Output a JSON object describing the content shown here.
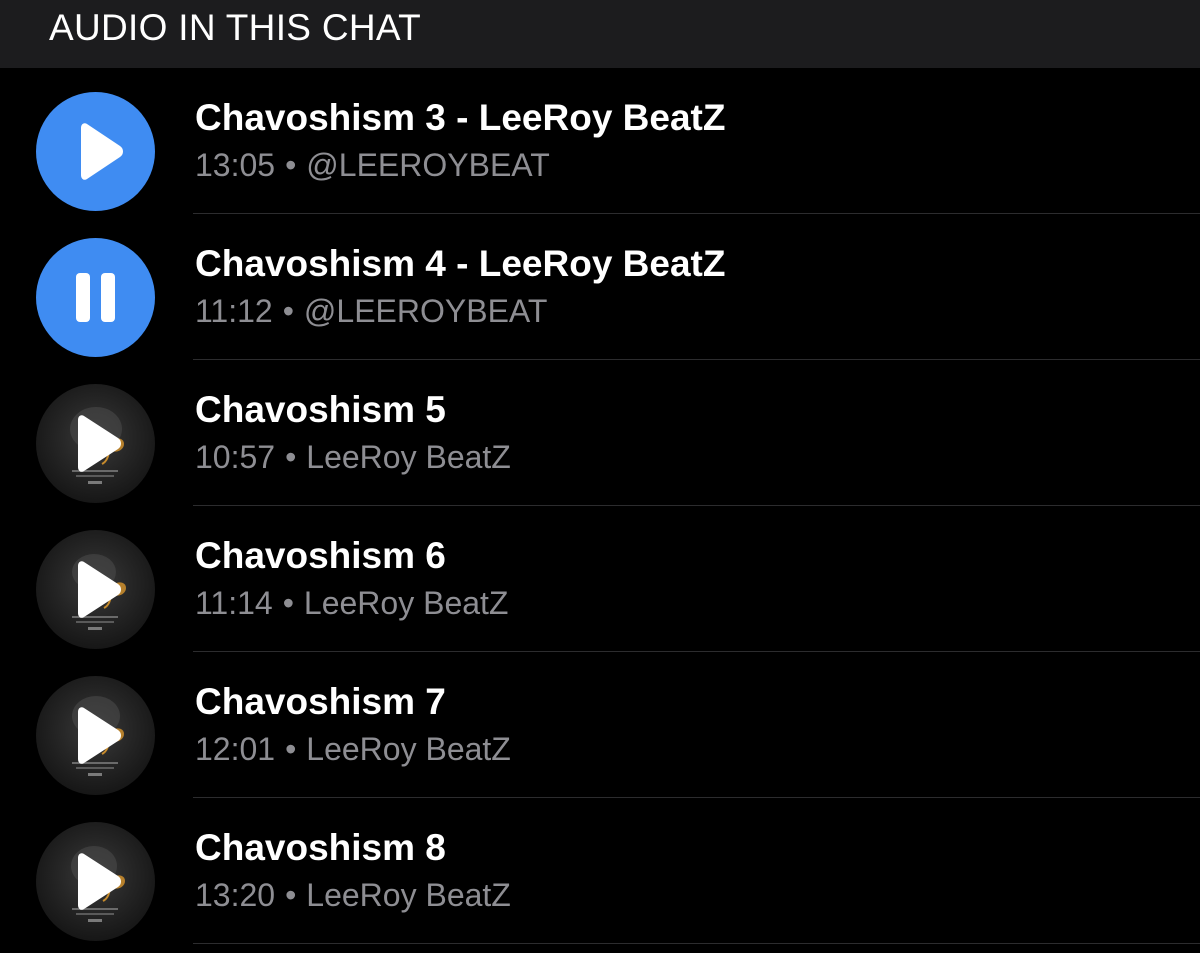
{
  "header": {
    "title": "AUDIO IN THIS CHAT"
  },
  "colors": {
    "header_background": "#1c1c1e",
    "accent_blue": "#3f8cf2",
    "title_text": "#ffffff",
    "meta_text": "#8e8e93",
    "separator": "#2c2c2e"
  },
  "tracks": [
    {
      "title": "Chavoshism 3 - LeeRoy BeatZ",
      "duration": "13:05",
      "separator_dot": "•",
      "source": "@LEEROYBEAT",
      "control_icon": "play-icon",
      "thumbnail": "blue-circle"
    },
    {
      "title": "Chavoshism 4 - LeeRoy BeatZ",
      "duration": "11:12",
      "separator_dot": "•",
      "source": "@LEEROYBEAT",
      "control_icon": "pause-icon",
      "thumbnail": "blue-circle"
    },
    {
      "title": "Chavoshism 5",
      "duration": "10:57",
      "separator_dot": "•",
      "source": "LeeRoy BeatZ",
      "control_icon": "play-icon",
      "thumbnail": "album-art"
    },
    {
      "title": "Chavoshism 6",
      "duration": "11:14",
      "separator_dot": "•",
      "source": "LeeRoy BeatZ",
      "control_icon": "play-icon",
      "thumbnail": "album-art"
    },
    {
      "title": "Chavoshism 7",
      "duration": "12:01",
      "separator_dot": "•",
      "source": "LeeRoy BeatZ",
      "control_icon": "play-icon",
      "thumbnail": "album-art"
    },
    {
      "title": "Chavoshism 8",
      "duration": "13:20",
      "separator_dot": "•",
      "source": "LeeRoy BeatZ",
      "control_icon": "play-icon",
      "thumbnail": "album-art"
    }
  ]
}
